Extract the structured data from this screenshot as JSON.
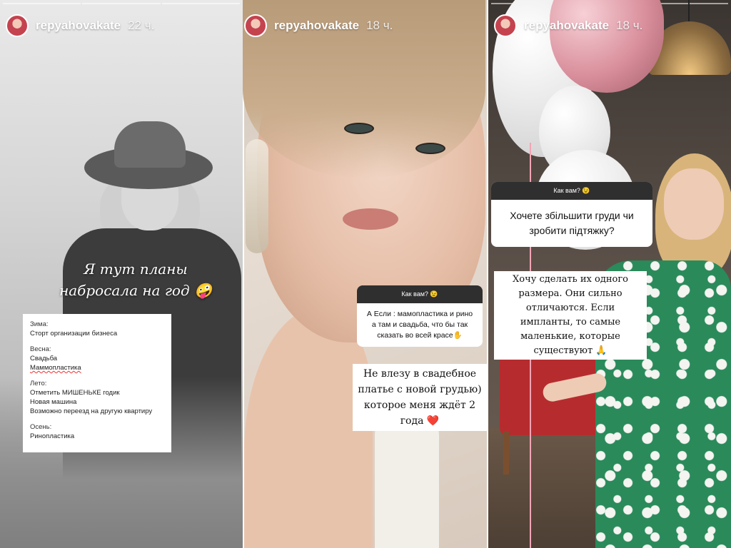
{
  "stories": [
    {
      "username": "repyahovakate",
      "time": "22 ч.",
      "caption": "Я тут планы набросала на год 🤪",
      "plan": {
        "winter_label": "Зима:",
        "winter_items": [
          "Сторт организации бизнеса"
        ],
        "spring_label": "Весна:",
        "spring_items": [
          "Свадьба",
          "Маммопластика"
        ],
        "summer_label": "Лето:",
        "summer_items": [
          "Отметить МИШЕНЬКЕ годик",
          "Новая машина",
          "Возможно переезд на другую квартиру"
        ],
        "autumn_label": "Осень:",
        "autumn_items": [
          "Ринопластика"
        ]
      }
    },
    {
      "username": "repyahovakate",
      "time": "18 ч.",
      "question_header": "Как вам? 😉",
      "question": "А Если : мамопластика и рино а там и свадьба, что бы так сказать во всей красе✋",
      "answer": "Не влезу в свадебное платье с новой грудью) которое меня ждёт 2 года ❤️"
    },
    {
      "username": "repyahovakate",
      "time": "18 ч.",
      "question_header": "Как вам? 😉",
      "question": "Хочете збільшити груди чи зробити підтяжку?",
      "answer": "Хочу сделать их одного размера. Они сильно отличаются. Если импланты, то самые маленькие, которые существуют 🙏"
    }
  ],
  "colors": {
    "card_header": "#2f2f2f",
    "card_body": "#ffffff",
    "underline_red": "#e33333",
    "dress_green": "#2a8a5a",
    "chair_red": "#b62c2e",
    "balloon_pink": "#d98f9c"
  },
  "icons": {
    "avatar": "avatar-icon"
  }
}
